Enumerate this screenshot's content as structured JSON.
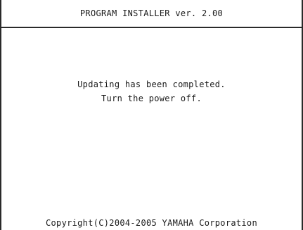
{
  "header": {
    "title": "PROGRAM INSTALLER ver. 2.00"
  },
  "message": {
    "line1": "Updating has been completed.",
    "line2": "Turn the power off."
  },
  "footer": {
    "copyright": "Copyright(C)2004-2005 YAMAHA Corporation"
  }
}
